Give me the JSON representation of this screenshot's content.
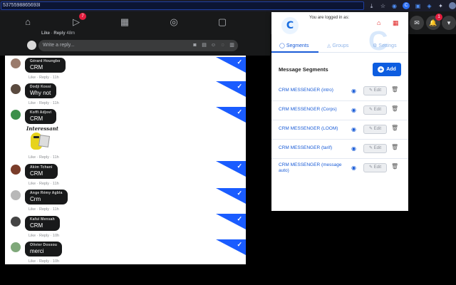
{
  "browser": {
    "url": "5375598865693I",
    "icons": [
      "download-icon",
      "star-icon",
      "extension-icon",
      "extension-icon",
      "extension-icon",
      "puzzle-icon",
      "profile-icon"
    ]
  },
  "facebook": {
    "nav_icons": [
      "home-icon",
      "video-icon",
      "marketplace-icon",
      "groups-icon",
      "gaming-icon"
    ],
    "video_badge": "7",
    "notifications_badge": "1",
    "top_meta": {
      "like": "Like",
      "reply": "Reply",
      "time": "48m"
    },
    "reply_placeholder": "Write a reply...",
    "reply_tools": [
      "camera-icon",
      "gif-icon",
      "emoji-icon",
      "sticker-icon",
      "gif-icon"
    ]
  },
  "comments": [
    {
      "name": "Gérard Houngbo",
      "text": "CRM",
      "meta": "Like · Reply · 11h",
      "avatar_color": "#9a7b6c"
    },
    {
      "name": "Dodji Kossi",
      "text": "Why not",
      "meta": "Like · Reply · 11h",
      "avatar_color": "#5a4a3f"
    },
    {
      "name": "Koffi Adjovi",
      "text": "CRM",
      "meta": "Like · Reply · 11h",
      "avatar_color": "#3c8f4a"
    },
    {
      "name": "Sticker",
      "text": "Interessant",
      "meta": "Like · Reply · 11h",
      "avatar_color": "#ffffff"
    },
    {
      "name": "Akim Tchani",
      "text": "CRM",
      "meta": "Like · Reply · 11h",
      "avatar_color": "#7a3d2a"
    },
    {
      "name": "Ange Rémy Agbla",
      "text": "Crm",
      "meta": "Like · Reply · 11h",
      "avatar_color": "#b8b8b8"
    },
    {
      "name": "Kafui Mensah",
      "text": "CRM",
      "meta": "Like · Reply · 10h",
      "avatar_color": "#444444"
    },
    {
      "name": "Olivier Dossou",
      "text": "merci",
      "meta": "Like · Reply · 10h",
      "avatar_color": "#7fa87a"
    }
  ],
  "popup": {
    "logo_text": "C",
    "logged_in": "You are logged in as:",
    "tabs": [
      {
        "label": "Segments",
        "icon": "chat-icon"
      },
      {
        "label": "Groups",
        "icon": "groups-icon"
      },
      {
        "label": "Settings",
        "icon": "gear-icon"
      }
    ],
    "section_title": "Message Segments",
    "add_label": "Add",
    "edit_label": "Edit",
    "segments": [
      "CRM MESSENGER (intro)",
      "CRM MESSENGER (Corps)",
      "CRM MESSENGER (LOOM)",
      "CRM MESSENGER (tarif)",
      "CRM MESSENGER (message auto)"
    ]
  },
  "colors": {
    "accent_blue": "#1a5cd7",
    "add_button": "#0d5de0",
    "check_blue": "#1a5cff",
    "badge_red": "#e41e3f"
  }
}
